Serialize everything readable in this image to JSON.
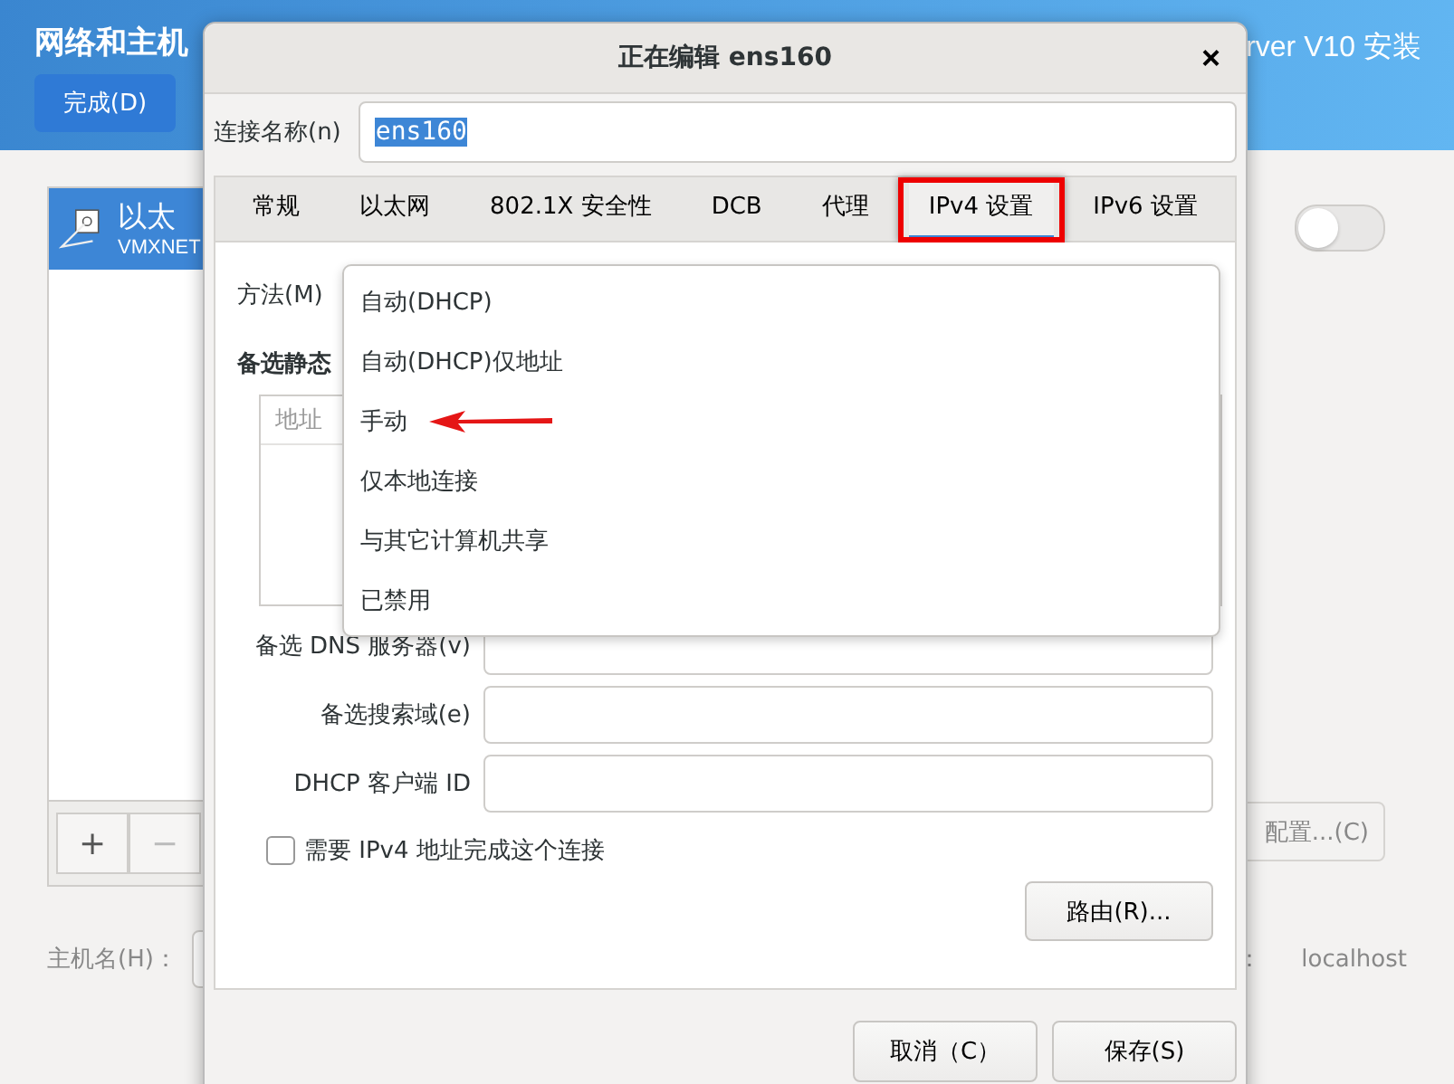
{
  "background_window": {
    "title": "网络和主机",
    "title_right": "rver V10 安装",
    "done_button": "完成(D)",
    "connections": [
      {
        "name": "以太",
        "device": "VMXNET",
        "selected": true
      }
    ],
    "add_button": "+",
    "remove_button": "−",
    "remove_disabled": true,
    "switch": {
      "on": false
    },
    "configure_button": "配置...(C)",
    "hostname_label": "主机名(H)：",
    "hostname_colon": "：",
    "hostname_current": "localhost"
  },
  "dialog": {
    "title": "正在编辑 ens160",
    "close": "×",
    "connection_name_label": "连接名称(n)",
    "connection_name": "ens160",
    "connection_name_selected": true,
    "tabs": [
      {
        "label": "常规",
        "selected": false,
        "highlighted": false
      },
      {
        "label": "以太网",
        "selected": false,
        "highlighted": false
      },
      {
        "label": "802.1X 安全性",
        "selected": false,
        "highlighted": false
      },
      {
        "label": "DCB",
        "selected": false,
        "highlighted": false
      },
      {
        "label": "代理",
        "selected": false,
        "highlighted": false
      },
      {
        "label": "IPv4 设置",
        "selected": true,
        "highlighted": true
      },
      {
        "label": "IPv6 设置",
        "selected": false,
        "highlighted": false
      }
    ],
    "method_label": "方法(M)",
    "method_options": [
      {
        "label": "自动(DHCP)",
        "pointed": false
      },
      {
        "label": "自动(DHCP)仅地址",
        "pointed": false
      },
      {
        "label": "手动",
        "pointed": true
      },
      {
        "label": "仅本地连接",
        "pointed": false
      },
      {
        "label": "与其它计算机共享",
        "pointed": false
      },
      {
        "label": "已禁用",
        "pointed": false
      }
    ],
    "static_heading": "备选静态",
    "address_column": "地址",
    "fields": [
      {
        "label": "备选 DNS 服务器(v)"
      },
      {
        "label": "备选搜索域(e)"
      },
      {
        "label": "DHCP 客户端 ID"
      }
    ],
    "require_checkbox": {
      "label": "需要 IPv4 地址完成这个连接",
      "checked": false
    },
    "routes_button": "路由(R)...",
    "buttons": [
      {
        "label": "取消（C）"
      },
      {
        "label": "保存(S)"
      }
    ]
  }
}
